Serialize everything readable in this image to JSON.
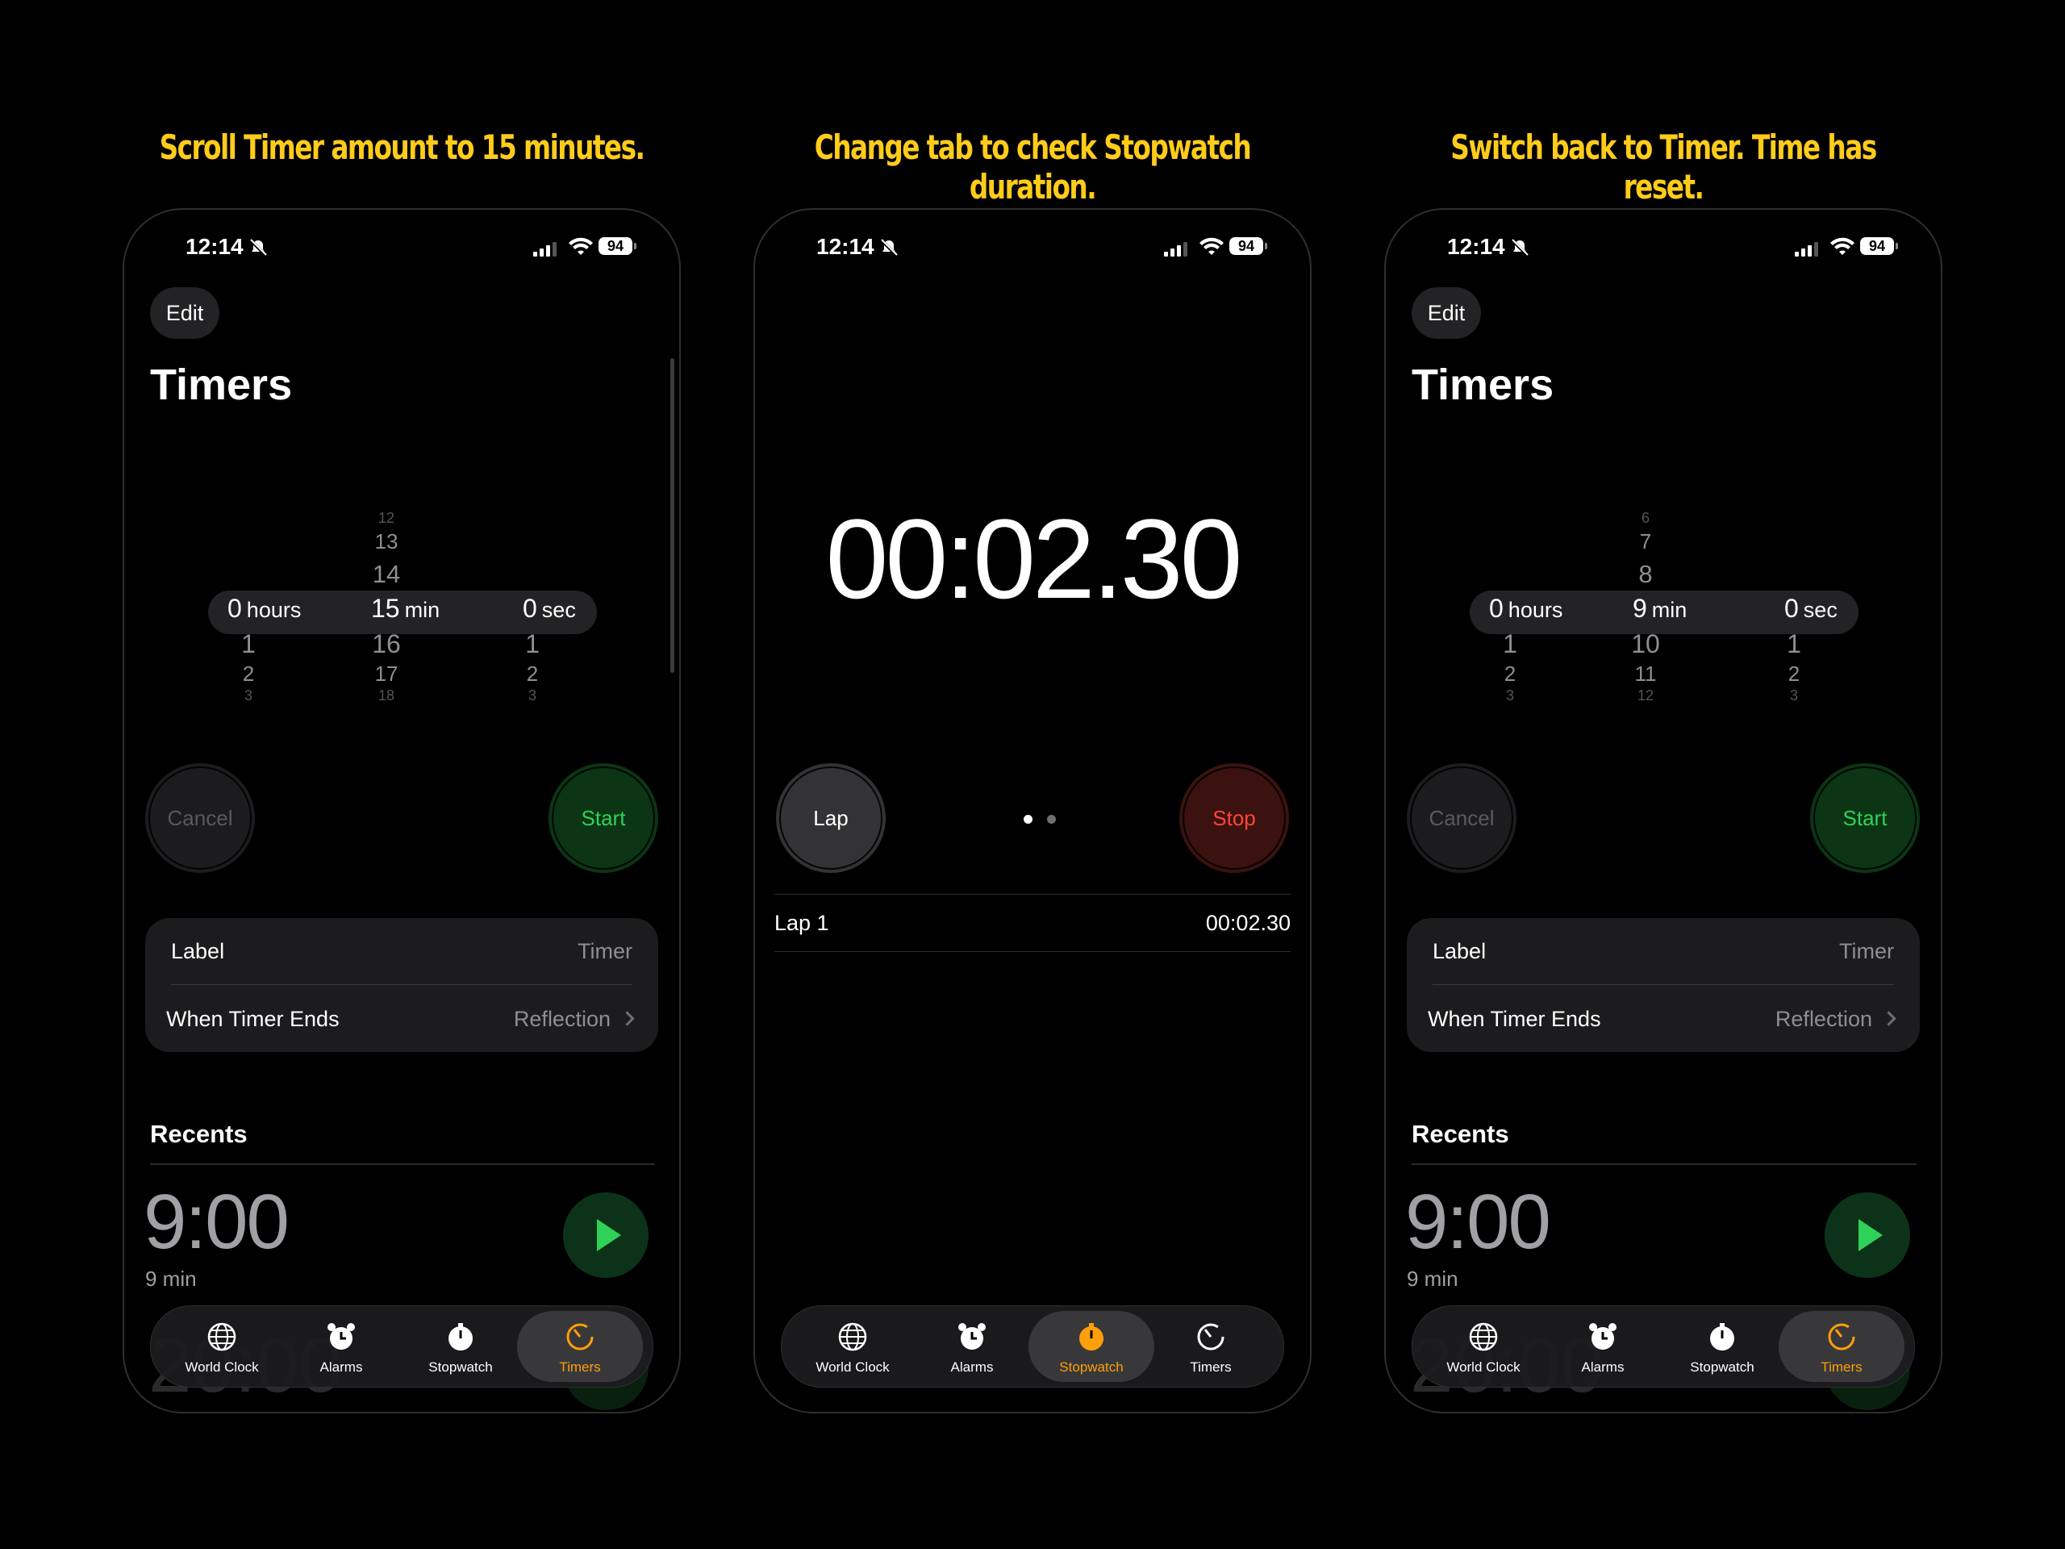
{
  "captions": [
    "Scroll Timer amount to 15 minutes.",
    "Change tab to check Stopwatch duration.",
    "Switch back to Timer. Time has reset."
  ],
  "status": {
    "time": "12:14",
    "battery": "94"
  },
  "colors": {
    "accent": "#FF9F0A",
    "caption": "#FFCC1A",
    "start": "#30D158",
    "stop": "#FF453A"
  },
  "timer_common": {
    "edit": "Edit",
    "title": "Timers",
    "cancel": "Cancel",
    "start": "Start",
    "label_row": {
      "label": "Label",
      "value": "Timer"
    },
    "ends_row": {
      "label": "When Timer Ends",
      "value": "Reflection"
    },
    "recents_title": "Recents",
    "recent": {
      "time": "9:00",
      "sub": "9 min"
    },
    "ghost_time": "20:00"
  },
  "screen1_picker": {
    "hours": {
      "above": [
        "",
        "",
        ""
      ],
      "value": "0",
      "unit": "hours",
      "below": [
        "1",
        "2",
        "3"
      ]
    },
    "min": {
      "above": [
        "12",
        "13",
        "14"
      ],
      "value": "15",
      "unit": "min",
      "below": [
        "16",
        "17",
        "18"
      ]
    },
    "sec": {
      "above": [
        "",
        "",
        ""
      ],
      "value": "0",
      "unit": "sec",
      "below": [
        "1",
        "2",
        "3"
      ]
    }
  },
  "screen3_picker": {
    "hours": {
      "above": [
        "",
        "",
        ""
      ],
      "value": "0",
      "unit": "hours",
      "below": [
        "1",
        "2",
        "3"
      ]
    },
    "min": {
      "above": [
        "6",
        "7",
        "8"
      ],
      "value": "9",
      "unit": "min",
      "below": [
        "10",
        "11",
        "12"
      ]
    },
    "sec": {
      "above": [
        "",
        "",
        ""
      ],
      "value": "0",
      "unit": "sec",
      "below": [
        "1",
        "2",
        "3"
      ]
    }
  },
  "stopwatch": {
    "time": "00:02.30",
    "lap": "Lap",
    "stop": "Stop",
    "lap_row": {
      "name": "Lap 1",
      "time": "00:02.30"
    }
  },
  "tabs": [
    {
      "label": "World Clock",
      "icon": "globe-icon"
    },
    {
      "label": "Alarms",
      "icon": "alarm-clock-icon"
    },
    {
      "label": "Stopwatch",
      "icon": "stopwatch-icon"
    },
    {
      "label": "Timers",
      "icon": "timer-icon"
    }
  ]
}
